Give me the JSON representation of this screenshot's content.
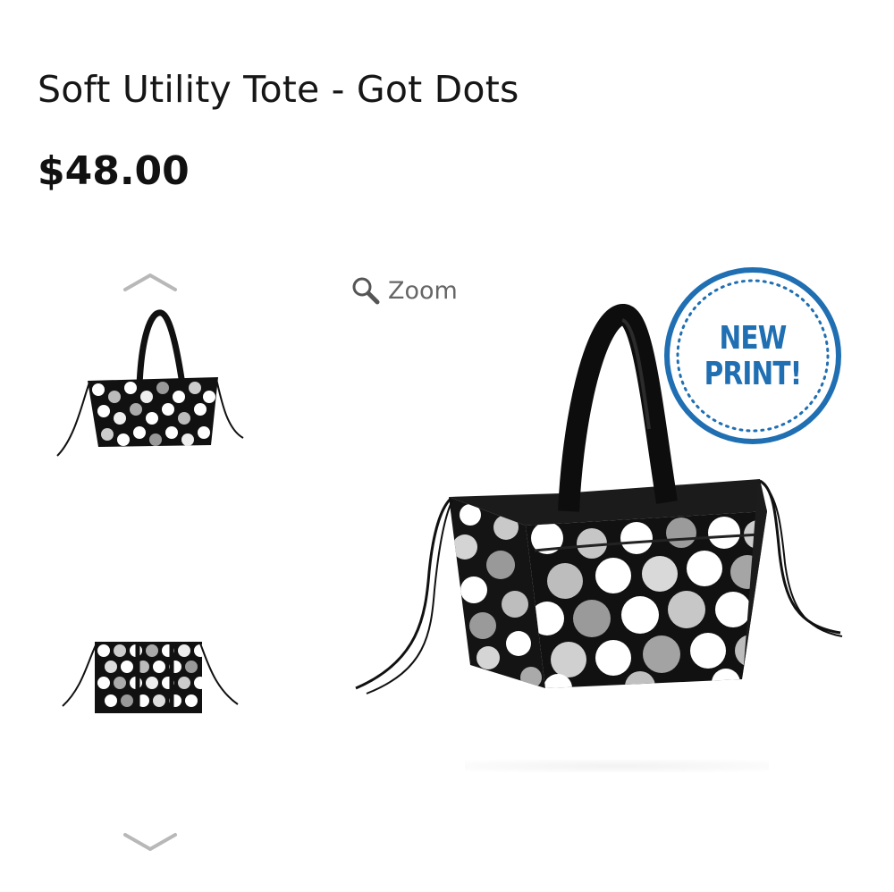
{
  "product": {
    "title": "Soft Utility Tote - Got Dots",
    "price": "$48.00"
  },
  "gallery": {
    "zoom_label": "Zoom",
    "badge_line1": "NEW",
    "badge_line2": "PRINT!",
    "thumbnails": [
      "tote-front-thumbnail",
      "tote-top-thumbnail"
    ],
    "icons": [
      "chevron-up-icon",
      "magnifier-icon",
      "chevron-down-icon"
    ],
    "colors": {
      "badge_blue": "#1f6fb2",
      "chevron_gray": "#b8b8b8",
      "zoom_gray": "#666666"
    }
  }
}
